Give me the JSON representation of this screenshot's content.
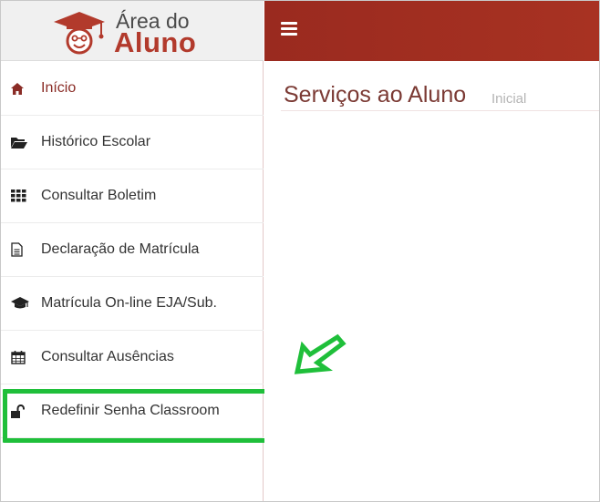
{
  "colors": {
    "header_bg": "#9b2b1e",
    "brand_red": "#b23a2c",
    "highlight_green": "#1fbf3a"
  },
  "logo": {
    "line1": "Área do",
    "line2": "Aluno"
  },
  "header": {
    "menu_icon": "hamburger-icon"
  },
  "sidebar": {
    "items": [
      {
        "label": "Início",
        "icon": "home-icon"
      },
      {
        "label": "Histórico Escolar",
        "icon": "folder-open-icon"
      },
      {
        "label": "Consultar Boletim",
        "icon": "grid-icon"
      },
      {
        "label": "Declaração de Matrícula",
        "icon": "document-icon"
      },
      {
        "label": "Matrícula On-line EJA/Sub.",
        "icon": "graduation-cap-icon"
      },
      {
        "label": "Consultar Ausências",
        "icon": "calendar-icon"
      },
      {
        "label": "Redefinir Senha Classroom",
        "icon": "unlock-icon"
      }
    ]
  },
  "main": {
    "title": "Serviços ao Aluno",
    "subtitle": "Inicial"
  }
}
